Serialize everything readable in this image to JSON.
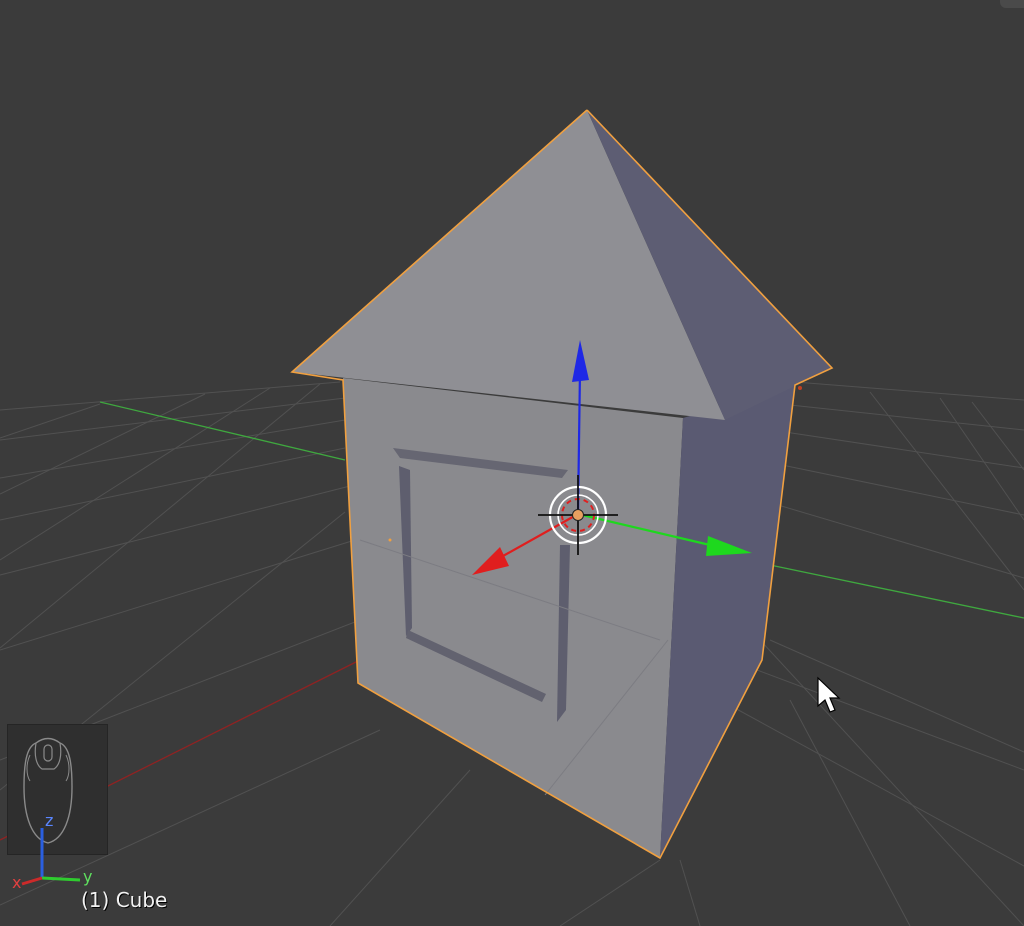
{
  "viewport": {
    "active_object_label": "(1) Cube",
    "background_color": "#3b3b3b"
  },
  "axes_gizmo": {
    "labels": {
      "x": "x",
      "y": "y",
      "z": "z"
    },
    "colors": {
      "x": "#cc2a2a",
      "y": "#2fcc2f",
      "z": "#2a5fe0"
    }
  },
  "transform_manipulator": {
    "colors": {
      "x": "#e01e1e",
      "y": "#1ed81e",
      "z": "#1e28e6"
    }
  },
  "selection": {
    "outline_color": "#f0a040",
    "origin_color": "#e8a060"
  },
  "icons": {
    "mouse_hint": "mouse-icon",
    "cursor": "arrow-cursor-icon",
    "3d_cursor": "crosshair-cursor-icon"
  }
}
